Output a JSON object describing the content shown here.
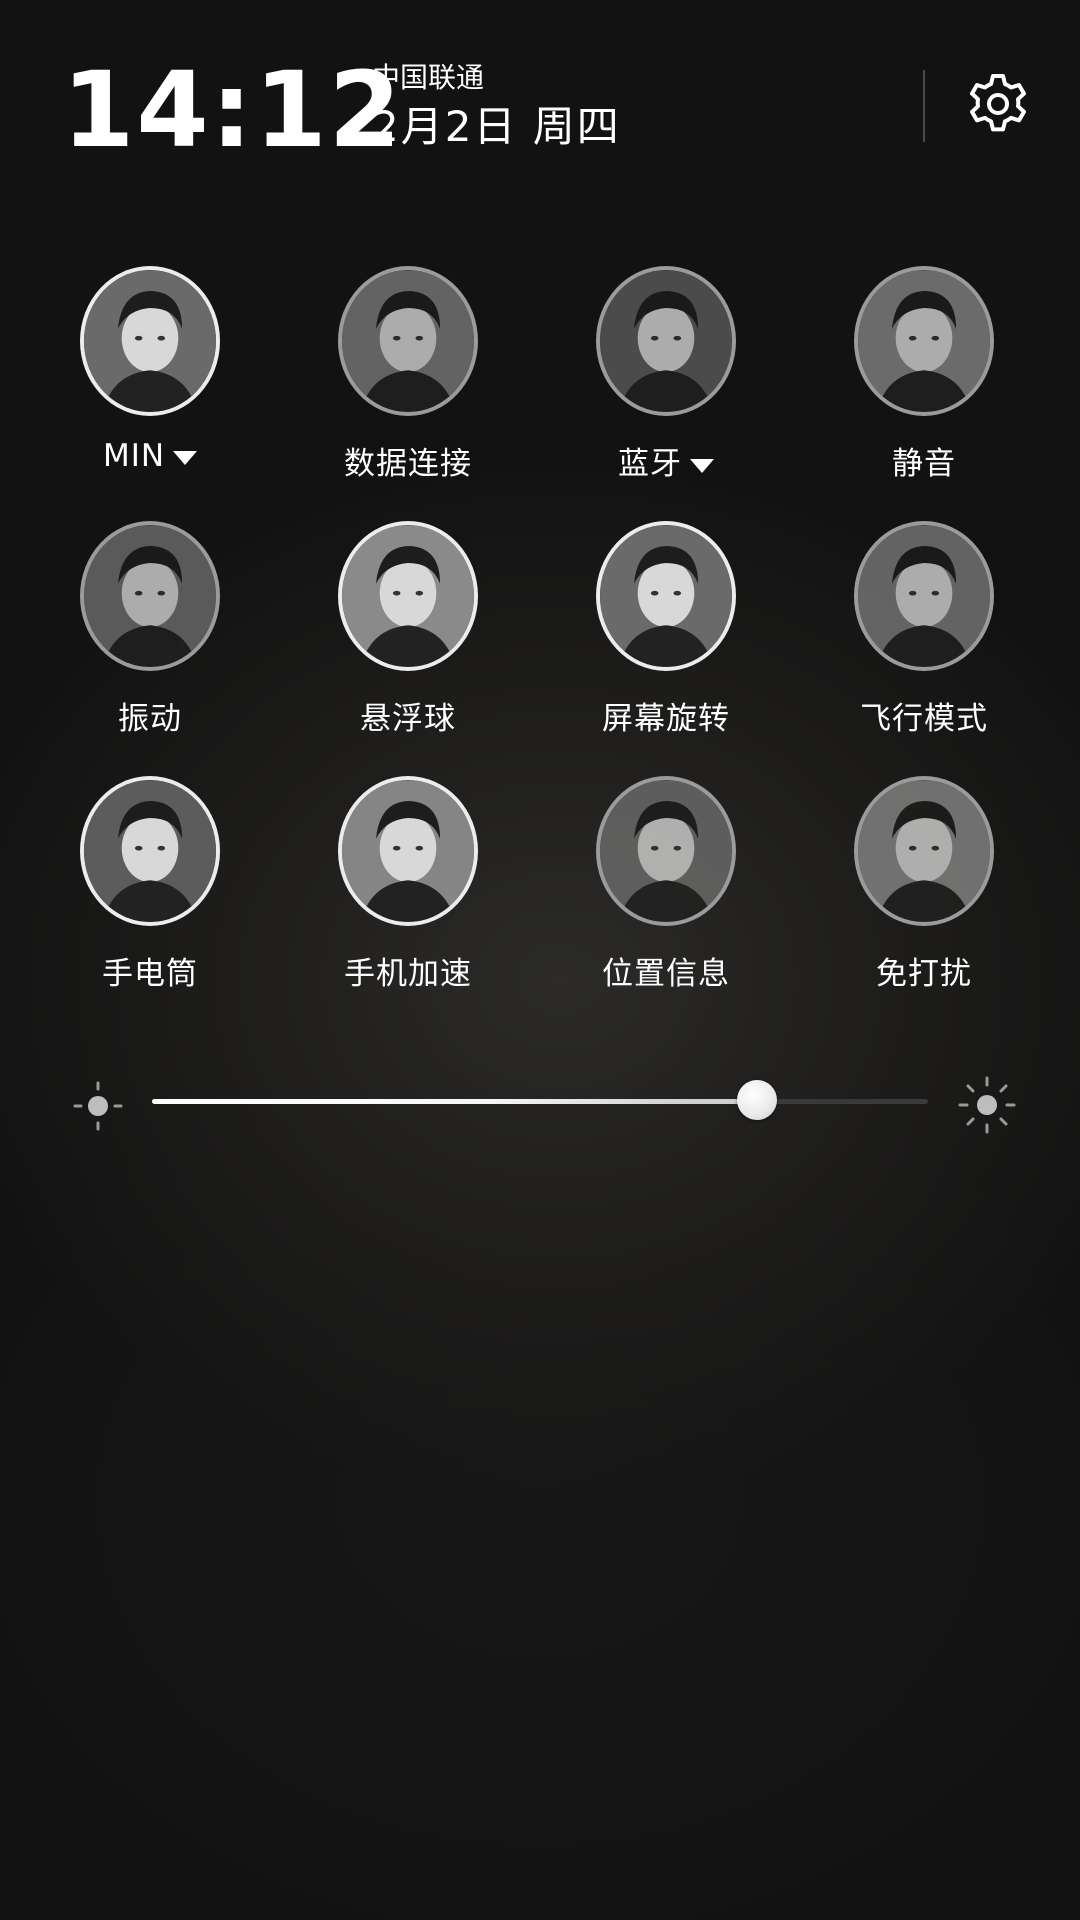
{
  "header": {
    "time": "14:12",
    "carrier": "中国联通",
    "date": "2月2日  周四",
    "settings_icon": "gear-icon"
  },
  "toggles": [
    {
      "label": "MIN",
      "has_dropdown": true,
      "active": true
    },
    {
      "label": "数据连接",
      "has_dropdown": false,
      "active": false
    },
    {
      "label": "蓝牙",
      "has_dropdown": true,
      "active": false
    },
    {
      "label": "静音",
      "has_dropdown": false,
      "active": false
    },
    {
      "label": "振动",
      "has_dropdown": false,
      "active": false
    },
    {
      "label": "悬浮球",
      "has_dropdown": false,
      "active": true
    },
    {
      "label": "屏幕旋转",
      "has_dropdown": false,
      "active": true
    },
    {
      "label": "飞行模式",
      "has_dropdown": false,
      "active": false
    },
    {
      "label": "手电筒",
      "has_dropdown": false,
      "active": true
    },
    {
      "label": "手机加速",
      "has_dropdown": false,
      "active": true
    },
    {
      "label": "位置信息",
      "has_dropdown": false,
      "active": false
    },
    {
      "label": "免打扰",
      "has_dropdown": false,
      "active": false
    }
  ],
  "brightness": {
    "level": 0.78,
    "min_icon": "sun-small-icon",
    "max_icon": "sun-large-icon"
  },
  "colors": {
    "background": "#131313",
    "active_ring": "#ececec",
    "inactive_ring": "#9b9b9b",
    "text": "#ffffff"
  }
}
